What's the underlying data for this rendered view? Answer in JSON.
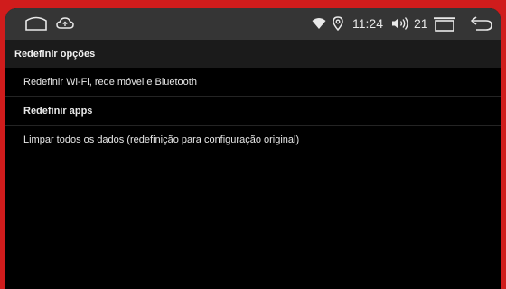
{
  "status_bar": {
    "icons": [
      "home-icon",
      "cloud-icon",
      "wifi-icon",
      "location-icon",
      "speaker-icon",
      "recent-apps-icon",
      "back-icon"
    ],
    "time": "11:24",
    "volume": "21"
  },
  "header": {
    "title": "Redefinir opções"
  },
  "options": [
    {
      "label": "Redefinir Wi-Fi, rede móvel e Bluetooth"
    },
    {
      "label": "Redefinir apps"
    },
    {
      "label": "Limpar todos os dados (redefinição para configuração original)"
    }
  ],
  "colors": {
    "frame": "#d01c1c",
    "status_bar_bg": "#353535",
    "header_bg": "#1b1b1b",
    "screen_bg": "#000000",
    "text": "#e8e8e8"
  }
}
